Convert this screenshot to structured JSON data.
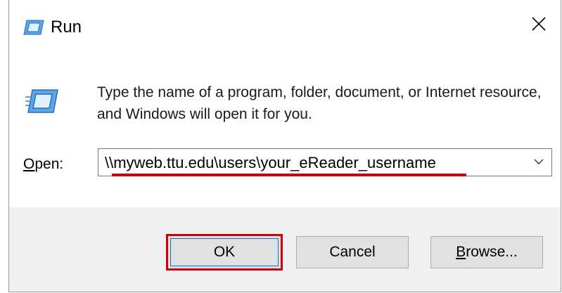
{
  "window": {
    "title": "Run",
    "close_icon": "close-icon"
  },
  "content": {
    "run_icon": "run-icon",
    "description": "Type the name of a program, folder, document, or Internet resource, and Windows will open it for you.",
    "open_label_accel": "O",
    "open_label_rest": "pen:",
    "open_value": "\\\\myweb.ttu.edu\\users\\your_eReader_username",
    "dropdown_icon": "chevron-down-icon",
    "highlight_color": "#d40000"
  },
  "buttons": {
    "ok_label": "OK",
    "cancel_label": "Cancel",
    "browse_accel": "B",
    "browse_rest": "rowse..."
  }
}
